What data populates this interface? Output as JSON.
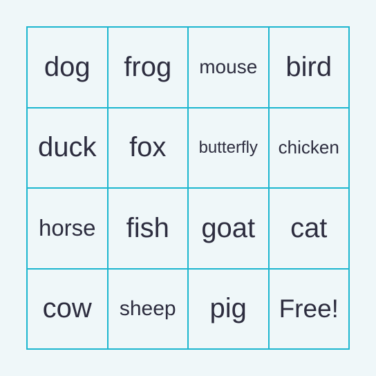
{
  "accent_color": "#1bb6cf",
  "text_color": "#2d2d3f",
  "cells": [
    {
      "label": "dog",
      "size": 40
    },
    {
      "label": "frog",
      "size": 40
    },
    {
      "label": "mouse",
      "size": 28
    },
    {
      "label": "bird",
      "size": 40
    },
    {
      "label": "duck",
      "size": 40
    },
    {
      "label": "fox",
      "size": 40
    },
    {
      "label": "butterfly",
      "size": 24
    },
    {
      "label": "chicken",
      "size": 26
    },
    {
      "label": "horse",
      "size": 33
    },
    {
      "label": "fish",
      "size": 40
    },
    {
      "label": "goat",
      "size": 40
    },
    {
      "label": "cat",
      "size": 40
    },
    {
      "label": "cow",
      "size": 40
    },
    {
      "label": "sheep",
      "size": 30
    },
    {
      "label": "pig",
      "size": 40
    },
    {
      "label": "Free!",
      "size": 37
    }
  ]
}
